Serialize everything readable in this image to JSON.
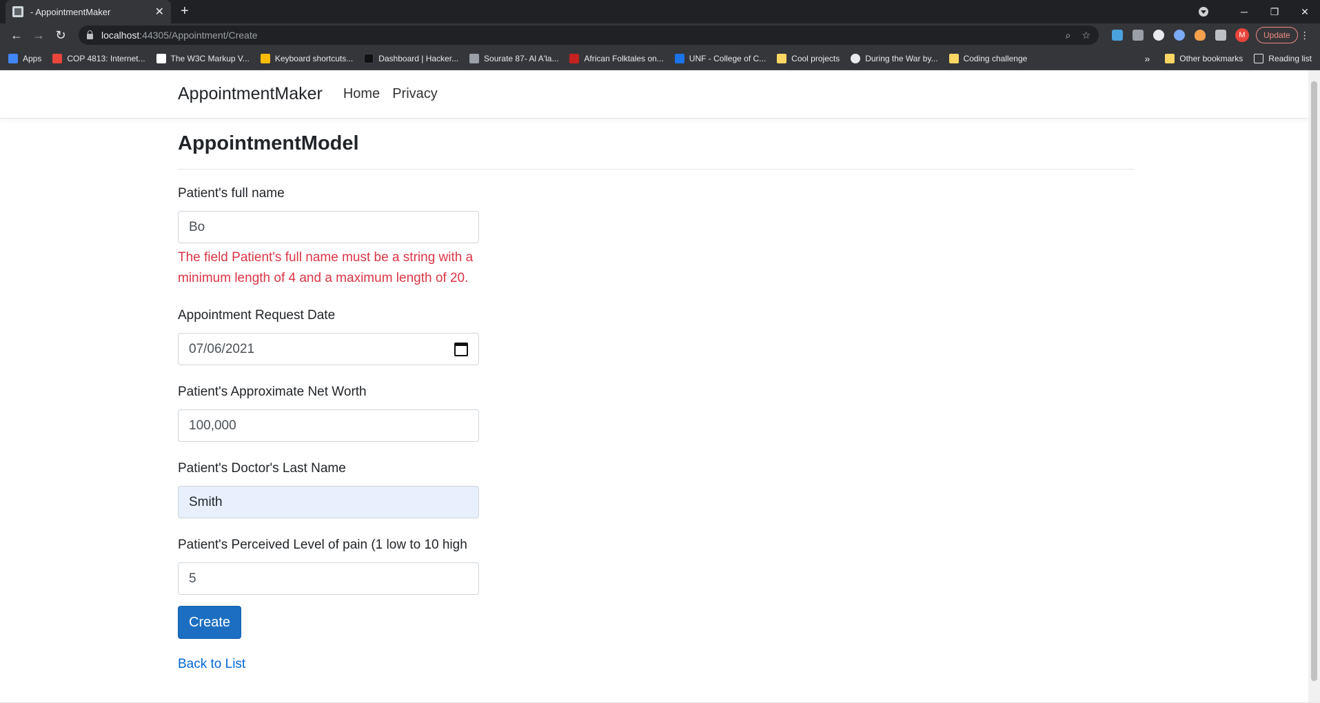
{
  "browser": {
    "tab_title": "- AppointmentMaker",
    "tab_close": "✕",
    "new_tab": "+",
    "url_host": "localhost",
    "url_path": ":44305/Appointment/Create",
    "update_label": "Update",
    "avatar_initial": "M",
    "window_controls": [
      "─",
      "❐",
      "✕"
    ]
  },
  "bookmarks": {
    "items": [
      {
        "label": "Apps",
        "color": "#4285f4"
      },
      {
        "label": "COP 4813: Internet...",
        "color": "#e8453c"
      },
      {
        "label": "The W3C Markup V...",
        "color": "#ffffff"
      },
      {
        "label": "Keyboard shortcuts...",
        "color": "#fbbc04"
      },
      {
        "label": "Dashboard | Hacker...",
        "color": "#111111"
      },
      {
        "label": "Sourate 87- Al A'la...",
        "color": "#9aa0a6"
      },
      {
        "label": "African Folktales on...",
        "color": "#c5221f"
      },
      {
        "label": "UNF - College of C...",
        "color": "#1a73e8"
      },
      {
        "label": "Cool projects",
        "color": "#fdd663"
      },
      {
        "label": "During the War by...",
        "color": "#e8eaed"
      },
      {
        "label": "Coding challenge",
        "color": "#fdd663"
      }
    ],
    "more": "»",
    "other": "Other bookmarks",
    "reading": "Reading list"
  },
  "app": {
    "brand": "AppointmentMaker",
    "nav": [
      "Home",
      "Privacy"
    ]
  },
  "form": {
    "heading": "AppointmentModel",
    "fullname_label": "Patient's full name",
    "fullname_value": "Bo",
    "fullname_error": "The field Patient's full name must be a string with a minimum length of 4 and a maximum length of 20.",
    "date_label": "Appointment Request Date",
    "date_value": "07/06/2021",
    "networth_label": "Patient's Approximate Net Worth",
    "networth_value": "100,000",
    "doctor_label": "Patient's Doctor's Last Name",
    "doctor_value": "Smith",
    "pain_label": "Patient's Perceived Level of pain (1 low to 10 high",
    "pain_value": "5",
    "create_label": "Create",
    "back_label": "Back to List"
  },
  "colors": {
    "primary": "#1b6ec2",
    "error": "#dc3545",
    "link": "#0366d6",
    "autofill": "#e8f0fe"
  }
}
